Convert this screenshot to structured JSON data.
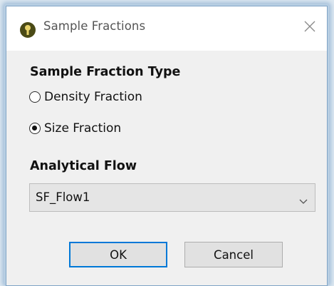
{
  "window": {
    "title": "Sample Fractions",
    "app_icon": "app-logo-icon",
    "close_icon": "close-icon"
  },
  "sample_fraction_type": {
    "heading": "Sample Fraction Type",
    "options": [
      {
        "label": "Density Fraction",
        "selected": false
      },
      {
        "label": "Size Fraction",
        "selected": true
      }
    ]
  },
  "analytical_flow": {
    "heading": "Analytical Flow",
    "selected_value": "SF_Flow1",
    "chevron_icon": "chevron-down-icon"
  },
  "buttons": {
    "ok_label": "OK",
    "cancel_label": "Cancel"
  },
  "colors": {
    "dialog_background": "#f0f0f0",
    "titlebar_background": "#ffffff",
    "default_button_border": "#0078d7",
    "icon_color": "#4a4a16"
  }
}
